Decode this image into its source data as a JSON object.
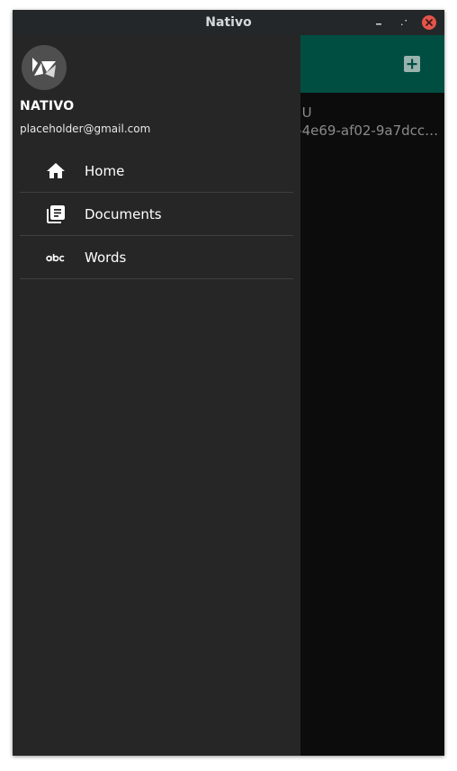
{
  "window": {
    "title": "Nativo",
    "buttons": {
      "minimize_icon": "minimize-icon",
      "maximize_icon": "maximize-icon",
      "close_icon": "close-icon",
      "close_color": "#e5544b"
    }
  },
  "toolbar": {
    "color": "#004e42",
    "action_icon": "add-box-icon"
  },
  "list": {
    "line1": "3:U",
    "line2": "a-4e69-af02-9a7dcc…"
  },
  "drawer": {
    "header": {
      "logo_icon": "kivy-logo-icon",
      "name": "NATIVO",
      "email": "placeholder@gmail.com"
    },
    "items": [
      {
        "label": "Home",
        "icon": "home-icon"
      },
      {
        "label": "Documents",
        "icon": "document-icon"
      },
      {
        "label": "Words",
        "icon": "abc-icon"
      }
    ]
  }
}
